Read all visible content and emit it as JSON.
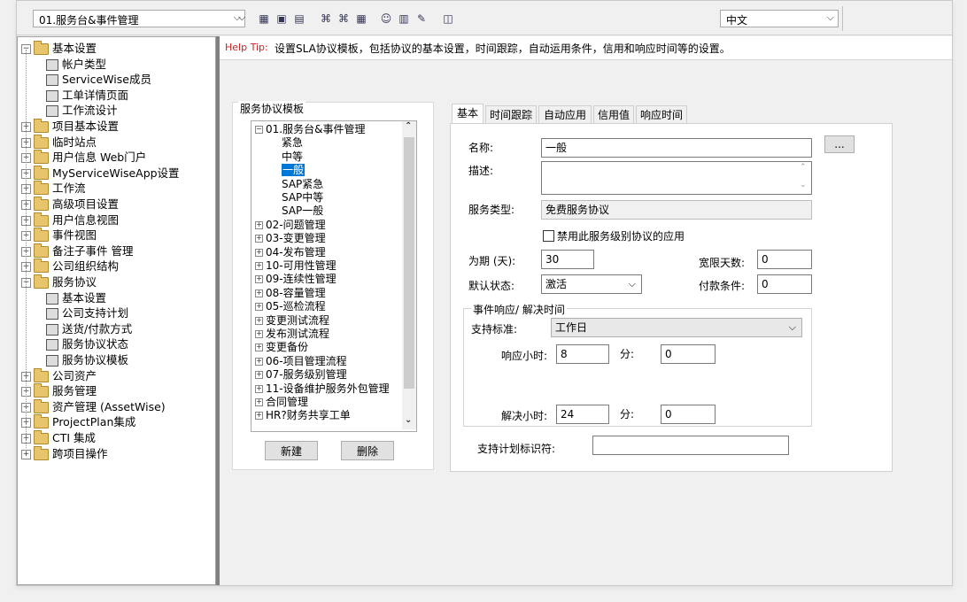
{
  "toolbar": {
    "project_select": "01.服务台&事件管理",
    "language_select": "中文"
  },
  "left_tree": [
    {
      "label": "基本设置",
      "type": "folder",
      "expanded": true,
      "level": 0
    },
    {
      "label": "帐户类型",
      "type": "leaf",
      "level": 1
    },
    {
      "label": "ServiceWise成员",
      "type": "leaf",
      "level": 1
    },
    {
      "label": "工单详情页面",
      "type": "leaf",
      "level": 1
    },
    {
      "label": "工作流设计",
      "type": "leaf",
      "level": 1
    },
    {
      "label": "项目基本设置",
      "type": "folder",
      "level": 0
    },
    {
      "label": "临时站点",
      "type": "folder",
      "level": 0
    },
    {
      "label": "用户信息 Web门户",
      "type": "folder",
      "level": 0
    },
    {
      "label": "MyServiceWiseApp设置",
      "type": "folder",
      "level": 0
    },
    {
      "label": "工作流",
      "type": "folder",
      "level": 0
    },
    {
      "label": "高级项目设置",
      "type": "folder",
      "level": 0
    },
    {
      "label": "用户信息视图",
      "type": "folder",
      "level": 0
    },
    {
      "label": "事件视图",
      "type": "folder",
      "level": 0
    },
    {
      "label": "备注子事件 管理",
      "type": "folder",
      "level": 0
    },
    {
      "label": "公司组织结构",
      "type": "folder",
      "level": 0
    },
    {
      "label": "服务协议",
      "type": "folder",
      "expanded": true,
      "level": 0
    },
    {
      "label": "基本设置",
      "type": "leaf",
      "level": 1
    },
    {
      "label": "公司支持计划",
      "type": "leaf",
      "level": 1
    },
    {
      "label": "送货/付款方式",
      "type": "leaf",
      "level": 1
    },
    {
      "label": "服务协议状态",
      "type": "leaf",
      "level": 1
    },
    {
      "label": "服务协议模板",
      "type": "leaf",
      "level": 1,
      "selected": true
    },
    {
      "label": "公司资产",
      "type": "folder",
      "level": 0
    },
    {
      "label": "服务管理",
      "type": "folder",
      "level": 0
    },
    {
      "label": "资产管理 (AssetWise)",
      "type": "folder",
      "level": 0
    },
    {
      "label": "ProjectPlan集成",
      "type": "folder",
      "level": 0
    },
    {
      "label": "CTI 集成",
      "type": "folder",
      "level": 0
    },
    {
      "label": "跨项目操作",
      "type": "folder",
      "level": 0
    }
  ],
  "help": {
    "prefix": "Help Tip:",
    "text": "设置SLA协议模板，包括协议的基本设置，时间跟踪，自动运用条件，信用和响应时间等的设置。"
  },
  "template_panel": {
    "title": "服务协议模板",
    "items": [
      {
        "label": "01.服务台&事件管理",
        "level": 0,
        "expanded": true
      },
      {
        "label": "紧急",
        "level": 1
      },
      {
        "label": "中等",
        "level": 1
      },
      {
        "label": "一般",
        "level": 1,
        "selected": true
      },
      {
        "label": "SAP紧急",
        "level": 1
      },
      {
        "label": "SAP中等",
        "level": 1
      },
      {
        "label": "SAP一般",
        "level": 1
      },
      {
        "label": "02-问题管理",
        "level": 0
      },
      {
        "label": "03-变更管理",
        "level": 0
      },
      {
        "label": "04-发布管理",
        "level": 0
      },
      {
        "label": "10-可用性管理",
        "level": 0
      },
      {
        "label": "09-连续性管理",
        "level": 0
      },
      {
        "label": "08-容量管理",
        "level": 0
      },
      {
        "label": "05-巡检流程",
        "level": 0
      },
      {
        "label": "变更测试流程",
        "level": 0
      },
      {
        "label": "发布测试流程",
        "level": 0
      },
      {
        "label": "变更备份",
        "level": 0
      },
      {
        "label": "06-项目管理流程",
        "level": 0
      },
      {
        "label": "07-服务级别管理",
        "level": 0
      },
      {
        "label": "11-设备维护服务外包管理",
        "level": 0
      },
      {
        "label": "合同管理",
        "level": 0
      },
      {
        "label": "HR?财务共享工单",
        "level": 0
      }
    ],
    "new_button": "新建",
    "delete_button": "删除"
  },
  "tabs": [
    "基本",
    "时间跟踪",
    "自动应用",
    "信用值",
    "响应时间"
  ],
  "form": {
    "name_label": "名称:",
    "name_value": "一般",
    "ellipsis": "...",
    "desc_label": "描述:",
    "desc_value": "",
    "service_type_label": "服务类型:",
    "service_type_value": "免费服务协议",
    "disable_label": "禁用此服务级别协议的应用",
    "period_label": "为期 (天):",
    "period_value": "30",
    "grace_label": "宽限天数:",
    "grace_value": "0",
    "default_status_label": "默认状态:",
    "default_status_value": "激活",
    "payment_label": "付款条件:",
    "payment_value": "0",
    "group_label": "事件响应/ 解决时间",
    "support_std_label": "支持标准:",
    "support_std_value": "工作日",
    "response_hours_label": "响应小时:",
    "response_hours_value": "8",
    "minutes_label": "分:",
    "response_minutes_value": "0",
    "resolve_hours_label": "解决小时:",
    "resolve_hours_value": "24",
    "resolve_minutes_value": "0",
    "plan_id_label": "支持计划标识符:",
    "plan_id_value": ""
  }
}
